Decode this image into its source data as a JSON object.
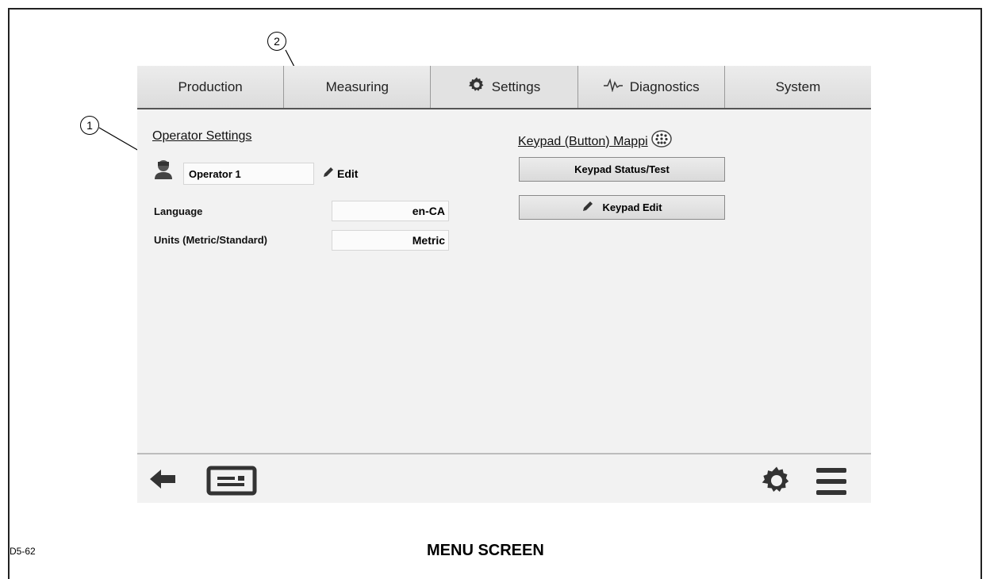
{
  "tabs": [
    {
      "label": "Production",
      "icon": ""
    },
    {
      "label": "Measuring",
      "icon": ""
    },
    {
      "label": "Settings",
      "icon": "gear-icon"
    },
    {
      "label": "Diagnostics",
      "icon": "waveform-icon"
    },
    {
      "label": "System",
      "icon": ""
    }
  ],
  "operator": {
    "title": "Operator Settings",
    "name": "Operator 1",
    "edit_label": "Edit",
    "language_label": "Language",
    "language_value": "en-CA",
    "units_label": "Units (Metric/Standard)",
    "units_value": "Metric"
  },
  "keypad": {
    "title": "Keypad (Button) Mappi",
    "status_button": "Keypad Status/Test",
    "edit_button": "Keypad Edit"
  },
  "callouts": {
    "one": "1",
    "two": "2"
  },
  "caption": "MENU SCREEN",
  "figure_id": "D5-62"
}
